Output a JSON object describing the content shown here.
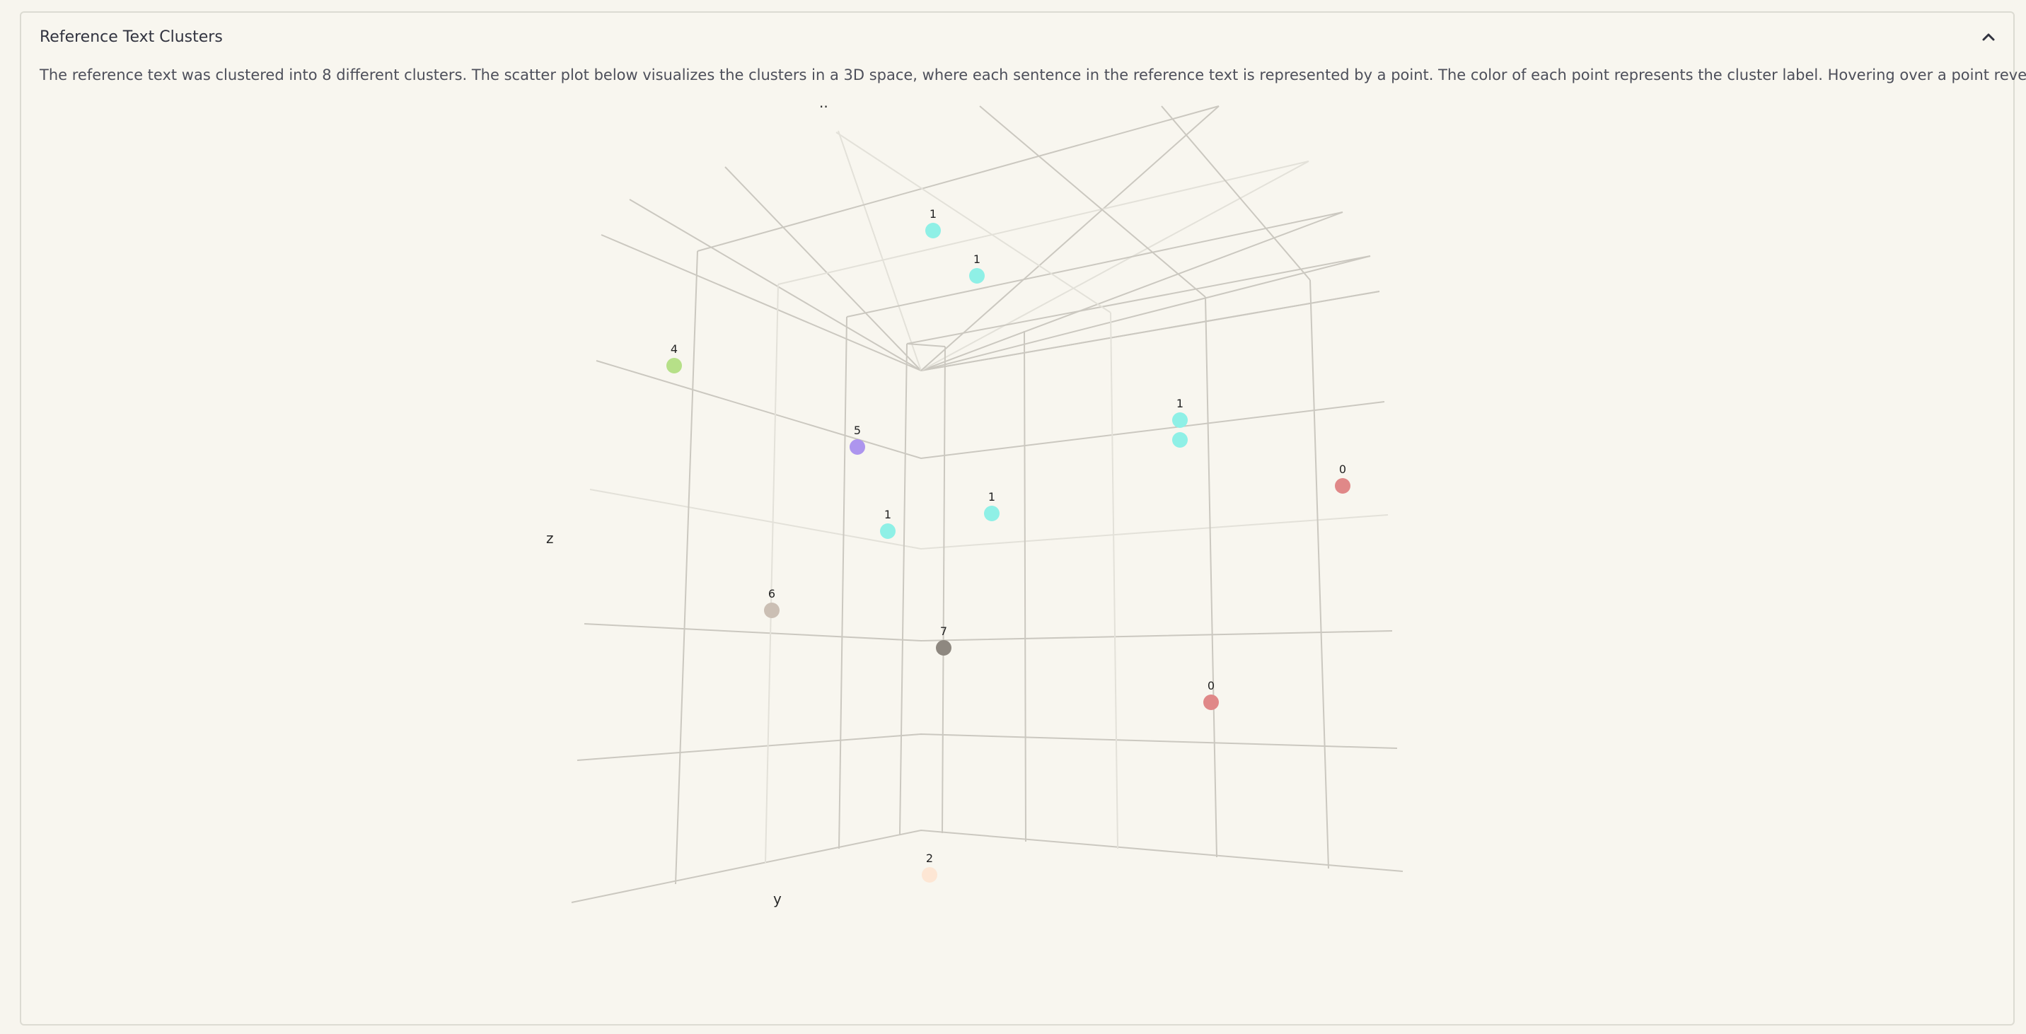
{
  "panel": {
    "title": "Reference Text Clusters",
    "description": "The reference text was clustered into 8 different clusters. The scatter plot below visualizes the clusters in a 3D space, where each sentence in the reference text is represented by a point. The color of each point represents the cluster label. Hovering over a point reveals its text.",
    "collapse_icon": "chevron-up-icon"
  },
  "chart_data": {
    "type": "scatter",
    "projection": "3d",
    "title": "",
    "axis_labels": {
      "x": "..",
      "y": "y",
      "z": "z"
    },
    "cluster_colors": {
      "0": "#e08888",
      "1": "#8ff0e6",
      "2": "#fde6d4",
      "4": "#b6e088",
      "5": "#ad95ee",
      "6": "#cbbfb4",
      "7": "#8e8880"
    },
    "points": [
      {
        "cluster": "1",
        "label": "1"
      },
      {
        "cluster": "1",
        "label": "1"
      },
      {
        "cluster": "4",
        "label": "4"
      },
      {
        "cluster": "5",
        "label": "5"
      },
      {
        "cluster": "1",
        "label": "1"
      },
      {
        "cluster": "1",
        "label": ""
      },
      {
        "cluster": "0",
        "label": "0"
      },
      {
        "cluster": "1",
        "label": "1"
      },
      {
        "cluster": "1",
        "label": "1"
      },
      {
        "cluster": "6",
        "label": "6"
      },
      {
        "cluster": "7",
        "label": "7"
      },
      {
        "cluster": "0",
        "label": "0"
      },
      {
        "cluster": "2",
        "label": "2"
      }
    ]
  }
}
